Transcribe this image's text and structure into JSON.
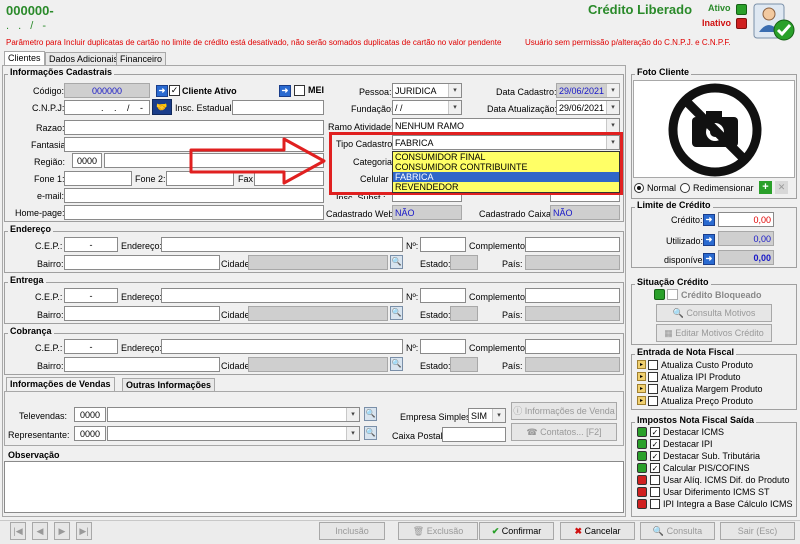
{
  "header": {
    "code_line1": "000000-",
    "code_line2": ". . / -",
    "title": "Crédito Liberado",
    "status_active": "Ativo",
    "status_inactive": "Inativo"
  },
  "warnings": {
    "w1": "Parâmetro para Incluir duplicatas de cartão no limite de crédito está desativado, não serão somados duplicatas de cartão no valor pendente",
    "w2": "Usuário sem permissão p/alteração do C.N.P.J. e C.N.P.F."
  },
  "tabs": [
    "Clientes",
    "Dados Adicionais",
    "Financeiro"
  ],
  "info": {
    "title": "Informações Cadastrais",
    "codigo_lbl": "Código:",
    "codigo": "000000",
    "cliente_ativo": "Cliente Ativo",
    "mei": "MEI",
    "cnpj_lbl": "C.N.P.J:",
    ".cnpj": ". . / -",
    "cnpj": ". . / -",
    "insc_lbl": "Insc. Estadual:",
    "razao_lbl": "Razao:",
    "fantasia_lbl": "Fantasia:",
    "regiao_lbl": "Região:",
    "regiao": "0000",
    "fone1_lbl": "Fone 1:",
    "fone2_lbl": "Fone 2:",
    "fax_lbl": "Fax",
    "email_lbl": "e-mail:",
    "home_lbl": "Home-page:",
    "pessoa_lbl": "Pessoa:",
    "pessoa": "JURIDICA",
    "fundacao_lbl": "Fundação:",
    "fundacao": "/ /",
    "data_cad_lbl": "Data Cadastro:",
    "data_cad": "29/06/2021",
    "data_atu_lbl": "Data Atualização:",
    "data_atu": "29/06/2021",
    "ramo_lbl": "Ramo Atividade:",
    "ramo": "NENHUM RAMO",
    "tipo_lbl": "Tipo Cadastro:",
    "tipo": "FABRICA",
    "categoria_lbl": "Categoria",
    "celular_lbl": "Celular",
    "insc_sub_lbl": "Insc. Subst.:",
    "cad_web_lbl": "Cadastrado Web:",
    "cad_web": "NÃO",
    "cad_caixa_lbl": "Cadastrado Caixa:",
    "cad_caixa": "NÃO"
  },
  "dropdown": {
    "options": [
      "CONSUMIDOR FINAL",
      "CONSUMIDOR CONTRIBUINTE",
      "FABRICA",
      "REVENDEDOR"
    ],
    "selected": "FABRICA"
  },
  "endereco": {
    "title": "Endereço",
    "cep_lbl": "C.E.P.:",
    "cep": "-",
    "end_lbl": "Endereço:",
    "num_lbl": "Nº:",
    "comp_lbl": "Complemento:",
    "bairro_lbl": "Bairro:",
    "cidade_lbl": "Cidade:",
    "estado_lbl": "Estado:",
    "pais_lbl": "País:"
  },
  "entrega": {
    "title": "Entrega",
    "cep_lbl": "C.E.P.:",
    "cep": "-",
    "end_lbl": "Endereço:",
    "num_lbl": "Nº:",
    "comp_lbl": "Complemento:",
    "bairro_lbl": "Bairro:",
    "cidade_lbl": "Cidade:",
    "estado_lbl": "Estado:",
    "pais_lbl": "País:"
  },
  "cobranca": {
    "title": "Cobrança",
    "cep_lbl": "C.E.P.:",
    "cep": "-",
    "end_lbl": "Endereço:",
    "num_lbl": "Nº:",
    "comp_lbl": "Complemento:",
    "bairro_lbl": "Bairro:",
    "cidade_lbl": "Cidade:",
    "estado_lbl": "Estado:",
    "pais_lbl": "País:"
  },
  "vendas": {
    "tab1": "Informações de Vendas",
    "tab2": "Outras Informações",
    "televendas_lbl": "Televendas:",
    "televendas": "0000",
    "repr_lbl": "Representante:",
    "repr": "0000",
    "empresa_lbl": "Empresa Simples:",
    "empresa": "SIM",
    "caixa_lbl": "Caixa Postal:",
    "info_btn": "Informações de Venda",
    "contatos_btn": "Contatos... [F2]"
  },
  "obs": {
    "title": "Observação"
  },
  "foto": {
    "title": "Foto Cliente",
    "normal": "Normal",
    "redim": "Redimensionar"
  },
  "limite": {
    "title": "Limite de Crédito",
    "credito_lbl": "Crédito:",
    "credito": "0,00",
    "utilizado_lbl": "Utilizado:",
    "utilizado": "0,00",
    "disp_lbl": "disponível:",
    "disp": "0,00"
  },
  "situacao": {
    "title": "Situação Crédito",
    "bloqueado": "Crédito Bloqueado",
    "consulta": "Consulta Motivos Crédito",
    "editar": "Editar Motivos Crédito"
  },
  "entrada": {
    "title": "Entrada de Nota Fiscal",
    "items": [
      "Atualiza Custo Produto",
      "Atualiza IPI Produto",
      "Atualiza Margem Produto",
      "Atualiza Preço Produto"
    ]
  },
  "impostos": {
    "title": "Impostos Nota Fiscal Saída",
    "items": [
      "Destacar ICMS",
      "Destacar IPI",
      "Destacar Sub. Tributária",
      "Calcular PIS/COFINS",
      "Usar Alíq. ICMS Dif. do Produto",
      "Usar Diferimento ICMS ST",
      "IPI Integra a Base Cálculo ICMS"
    ]
  },
  "footer": {
    "inclusao": "Inclusão",
    "exclusao": "Exclusão",
    "confirmar": "Confirmar",
    "cancelar": "Cancelar",
    "consulta": "Consulta",
    "sair": "Sair (Esc)"
  },
  "colors": {
    "warn": "#e00000",
    "title_green": "#2a8a2a",
    "dd_yellow": "#ffff66",
    "dd_sel": "#3066c8",
    "arrow_red": "#e02020"
  }
}
